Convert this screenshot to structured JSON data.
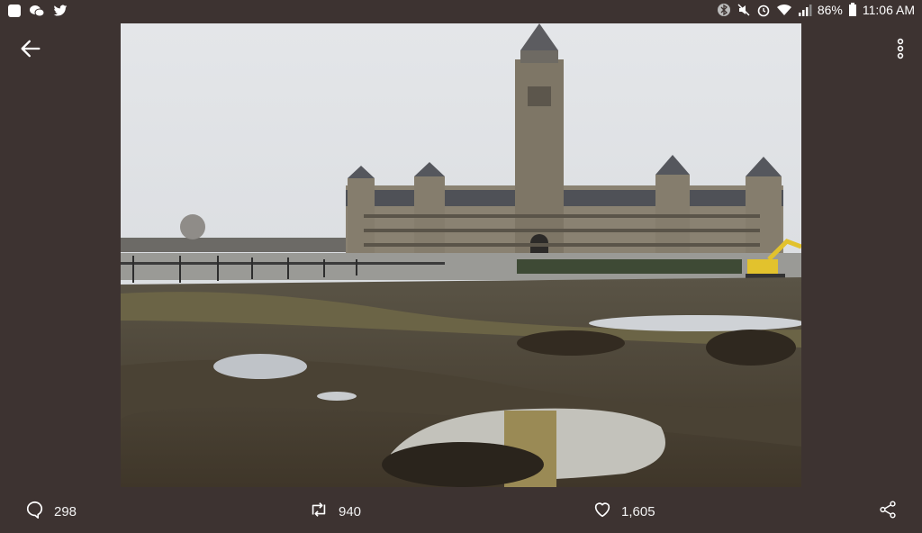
{
  "status_bar": {
    "battery": "86%",
    "time": "11:06 AM",
    "left_icons": [
      "app-square-icon",
      "wechat-icon",
      "twitter-bird-icon"
    ],
    "right_icons": [
      "bluetooth-icon",
      "mute-icon",
      "alarm-icon",
      "wifi-icon",
      "signal-icon",
      "battery-icon"
    ]
  },
  "toolbar": {
    "back_icon": "arrow-left-icon",
    "more_icon": "vertical-dots-icon"
  },
  "photo": {
    "subject": "Parliament building behind muddy torn-up lawn"
  },
  "actions": {
    "reply_count": "298",
    "retweet_count": "940",
    "like_count": "1,605"
  },
  "colors": {
    "background": "#3d3331",
    "icon": "#ffffff"
  }
}
